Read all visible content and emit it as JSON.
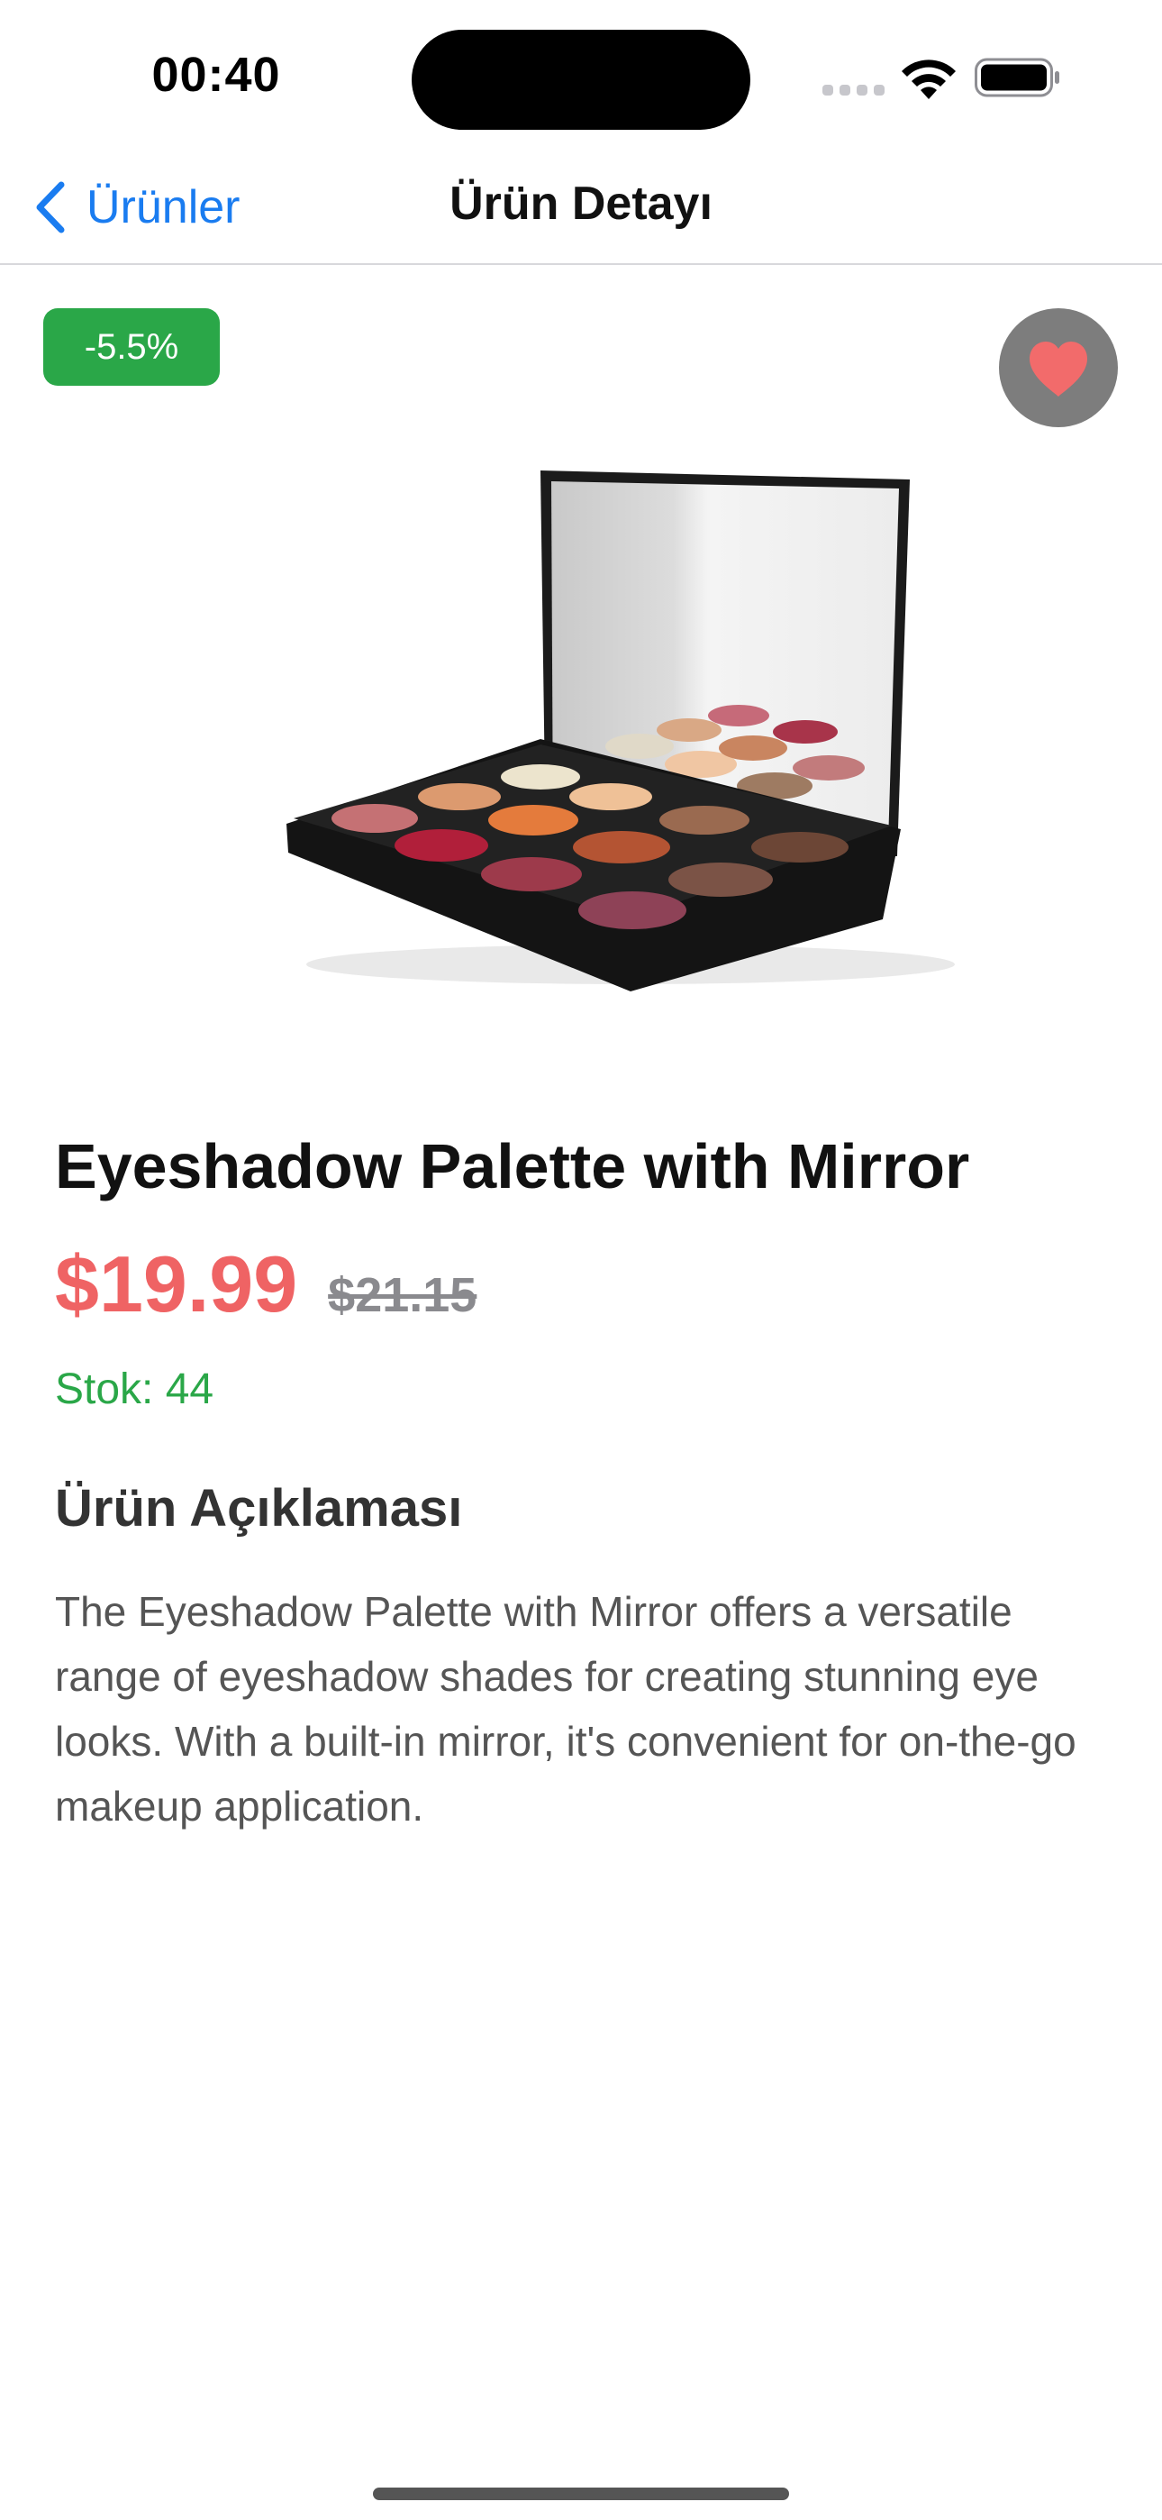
{
  "status_bar": {
    "time": "00:40",
    "icons": [
      "signal-icon",
      "wifi-icon",
      "battery-icon"
    ]
  },
  "nav": {
    "back_label": "Ürünler",
    "title": "Ürün Detayı"
  },
  "product": {
    "discount_badge": "-5.5%",
    "name": "Eyeshadow Palette with Mirror",
    "price": "$19.99",
    "original_price": "$21.15",
    "stock": "Stok: 44",
    "description_title": "Ürün Açıklaması",
    "description": "The Eyeshadow Palette with Mirror offers a versatile range of eyeshadow shades for creating stunning eye looks. With a built-in mirror, it's convenient for on-the-go makeup application.",
    "image_icon": "eyeshadow-palette-image",
    "favorite_icon": "heart-icon"
  },
  "colors": {
    "accent_blue": "#1a7cf0",
    "price_red": "#ef6364",
    "stock_green": "#2aa748",
    "badge_green": "#2aa748",
    "favorite_bg": "#7d7d7d",
    "heart": "#f26b6b"
  }
}
